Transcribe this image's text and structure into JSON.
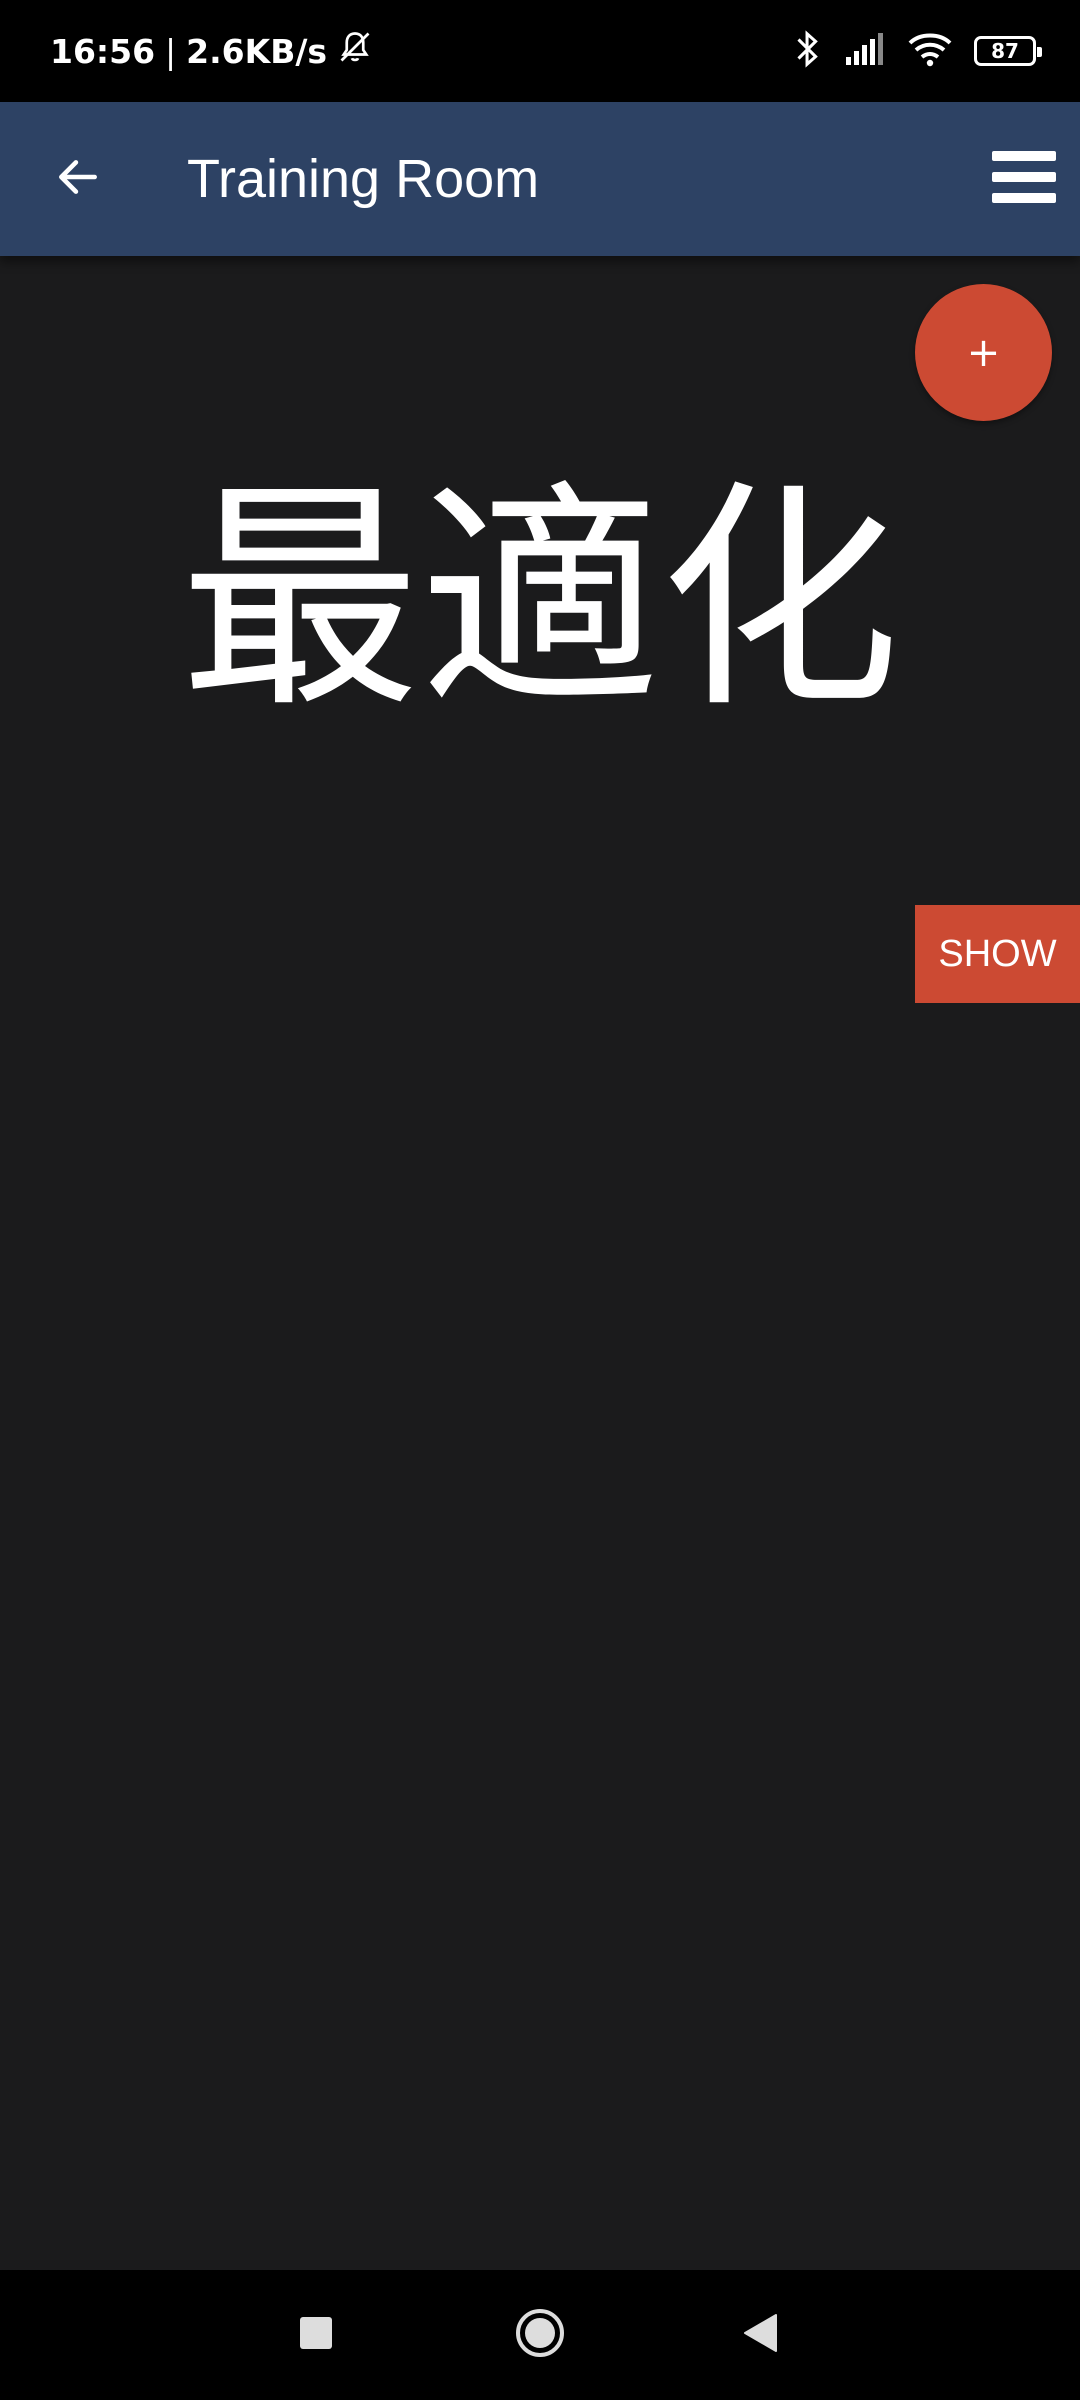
{
  "status_bar": {
    "time": "16:56",
    "separator": "|",
    "network_speed": "2.6KB/s",
    "battery_level": "87",
    "icons": [
      "mute-notifications-icon",
      "bluetooth-icon",
      "signal-icon",
      "wifi-icon",
      "battery-icon"
    ]
  },
  "app_bar": {
    "title": "Training Room",
    "back_icon": "arrow-back-icon",
    "menu_icon": "hamburger-menu-icon",
    "color": "#2d4264"
  },
  "main": {
    "fab_label": "+",
    "word": "最適化",
    "show_button_label": "SHOW",
    "accent_color": "#cc4a33",
    "background_color": "#1b1b1c"
  },
  "nav_bar": {
    "icons": [
      "recents-square-icon",
      "home-circle-icon",
      "back-triangle-icon"
    ]
  }
}
